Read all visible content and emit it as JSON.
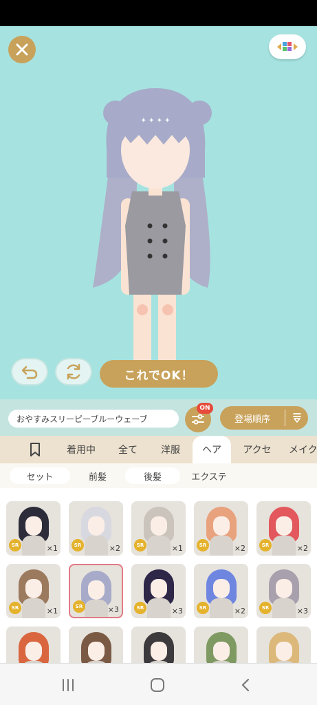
{
  "stage": {
    "ok_label": "これでOK！"
  },
  "outfit": {
    "name": "おやすみスリーピーブルーウェーブ",
    "filter_badge": "ON",
    "sort_label": "登場順序"
  },
  "tabs": [
    {
      "label": "",
      "icon": "bookmark-icon"
    },
    {
      "label": "着用中"
    },
    {
      "label": "全て"
    },
    {
      "label": "洋服"
    },
    {
      "label": "ヘア"
    },
    {
      "label": "アクセ"
    },
    {
      "label": "メイク"
    }
  ],
  "active_tab": "ヘア",
  "subtabs": [
    {
      "label": "セット"
    },
    {
      "label": "前髪"
    },
    {
      "label": "後髪"
    },
    {
      "label": "エクステ"
    }
  ],
  "active_subtab": "前髪",
  "items": [
    {
      "rarity": "SR",
      "count": "×1",
      "hair_color": "#2d2c3a"
    },
    {
      "rarity": "SR",
      "count": "×2",
      "hair_color": "#d8d8e0"
    },
    {
      "rarity": "SR",
      "count": "×1",
      "hair_color": "#cbc4bc"
    },
    {
      "rarity": "SR",
      "count": "×2",
      "hair_color": "#e8a27e"
    },
    {
      "rarity": "SR",
      "count": "×2",
      "hair_color": "#e2585c"
    },
    {
      "rarity": "SR",
      "count": "×1",
      "hair_color": "#9c7a5e"
    },
    {
      "rarity": "SR",
      "count": "×3",
      "hair_color": "#a7abc9",
      "selected": true
    },
    {
      "rarity": "SR",
      "count": "×3",
      "hair_color": "#2e2748"
    },
    {
      "rarity": "SR",
      "count": "×2",
      "hair_color": "#6f86e0"
    },
    {
      "rarity": "SR",
      "count": "×3",
      "hair_color": "#a9a0ad"
    },
    {
      "rarity": "",
      "count": "",
      "hair_color": "#d9663e"
    },
    {
      "rarity": "",
      "count": "",
      "hair_color": "#7b5a45"
    },
    {
      "rarity": "",
      "count": "",
      "hair_color": "#3c3a3c"
    },
    {
      "rarity": "",
      "count": "",
      "hair_color": "#7e9a62"
    },
    {
      "rarity": "",
      "count": "",
      "hair_color": "#dcb97a"
    }
  ],
  "colors": {
    "stage_bg": "#a6e3e0",
    "accent_gold": "#c8a25a",
    "badge_red": "#e64b3b",
    "selected_border": "#e27a85"
  }
}
